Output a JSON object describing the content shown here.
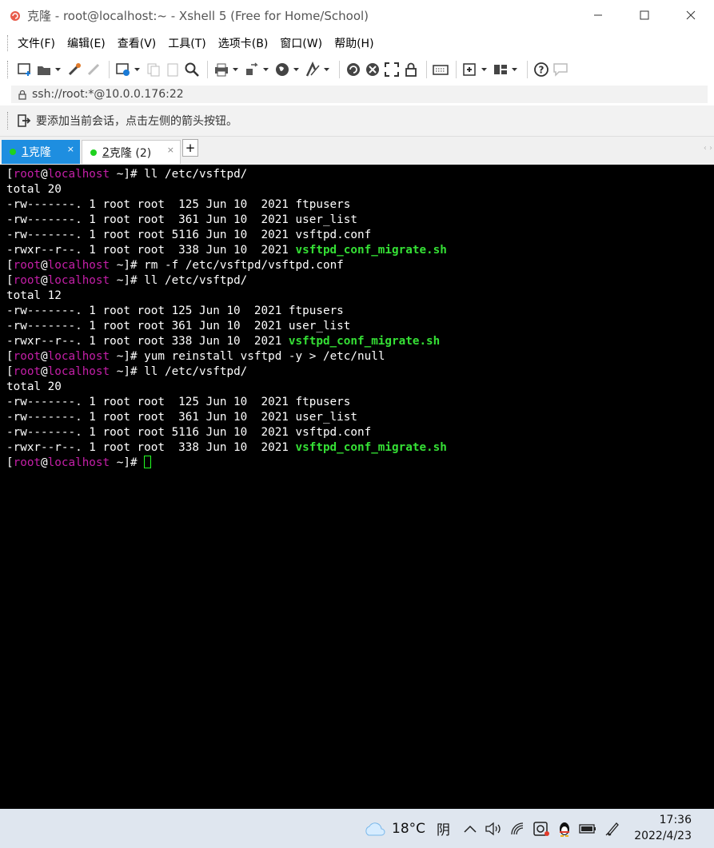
{
  "window": {
    "title": "克隆 - root@localhost:~ - Xshell 5 (Free for Home/School)",
    "app_icon": "xshell-snail-icon"
  },
  "menu": {
    "items": [
      "文件(F)",
      "编辑(E)",
      "查看(V)",
      "工具(T)",
      "选项卡(B)",
      "窗口(W)",
      "帮助(H)"
    ]
  },
  "address": {
    "url": "ssh://root:*@10.0.0.176:22",
    "lock_icon": "lock-icon"
  },
  "tip": {
    "text": "要添加当前会话，点击左侧的箭头按钮。"
  },
  "tabs": [
    {
      "num": "1",
      "label": " 克隆",
      "status_color": "#1fd21f",
      "active": true
    },
    {
      "num": "2",
      "label": " 克隆 (2)",
      "status_color": "#1fd21f",
      "active": false
    }
  ],
  "tab_close_symbol": "×",
  "tab_add_symbol": "+",
  "tab_scroll_symbol": "‹ ›",
  "terminal": {
    "prompt": {
      "open": "[",
      "user": "root",
      "at": "@",
      "host": "localhost",
      "path": " ~]# "
    },
    "lines": [
      {
        "type": "prompt",
        "cmd": "ll /etc/vsftpd/"
      },
      {
        "type": "out",
        "text": "total 20"
      },
      {
        "type": "out",
        "text": "-rw-------. 1 root root  125 Jun 10  2021 ftpusers"
      },
      {
        "type": "out",
        "text": "-rw-------. 1 root root  361 Jun 10  2021 user_list"
      },
      {
        "type": "out",
        "text": "-rw-------. 1 root root 5116 Jun 10  2021 vsftpd.conf"
      },
      {
        "type": "exec",
        "text": "-rwxr--r--. 1 root root  338 Jun 10  2021 ",
        "file": "vsftpd_conf_migrate.sh"
      },
      {
        "type": "prompt",
        "cmd": "rm -f /etc/vsftpd/vsftpd.conf"
      },
      {
        "type": "prompt",
        "cmd": "ll /etc/vsftpd/"
      },
      {
        "type": "out",
        "text": "total 12"
      },
      {
        "type": "out",
        "text": "-rw-------. 1 root root 125 Jun 10  2021 ftpusers"
      },
      {
        "type": "out",
        "text": "-rw-------. 1 root root 361 Jun 10  2021 user_list"
      },
      {
        "type": "exec",
        "text": "-rwxr--r--. 1 root root 338 Jun 10  2021 ",
        "file": "vsftpd_conf_migrate.sh"
      },
      {
        "type": "prompt",
        "cmd": "yum reinstall vsftpd -y > /etc/null"
      },
      {
        "type": "prompt",
        "cmd": "ll /etc/vsftpd/"
      },
      {
        "type": "out",
        "text": "total 20"
      },
      {
        "type": "out",
        "text": "-rw-------. 1 root root  125 Jun 10  2021 ftpusers"
      },
      {
        "type": "out",
        "text": "-rw-------. 1 root root  361 Jun 10  2021 user_list"
      },
      {
        "type": "out",
        "text": "-rw-------. 1 root root 5116 Jun 10  2021 vsftpd.conf"
      },
      {
        "type": "exec",
        "text": "-rwxr--r--. 1 root root  338 Jun 10  2021 ",
        "file": "vsftpd_conf_migrate.sh"
      },
      {
        "type": "prompt",
        "cmd": "",
        "cursor": true
      }
    ]
  },
  "taskbar": {
    "weather_temp": "18°C",
    "weather_desc": "阴",
    "time": "17:36",
    "date": "2022/4/23"
  },
  "colors": {
    "tab_active": "#1e8ee0",
    "prompt_user_host": "#c51fa8",
    "executable": "#35e035",
    "cursor": "#22ff22"
  }
}
